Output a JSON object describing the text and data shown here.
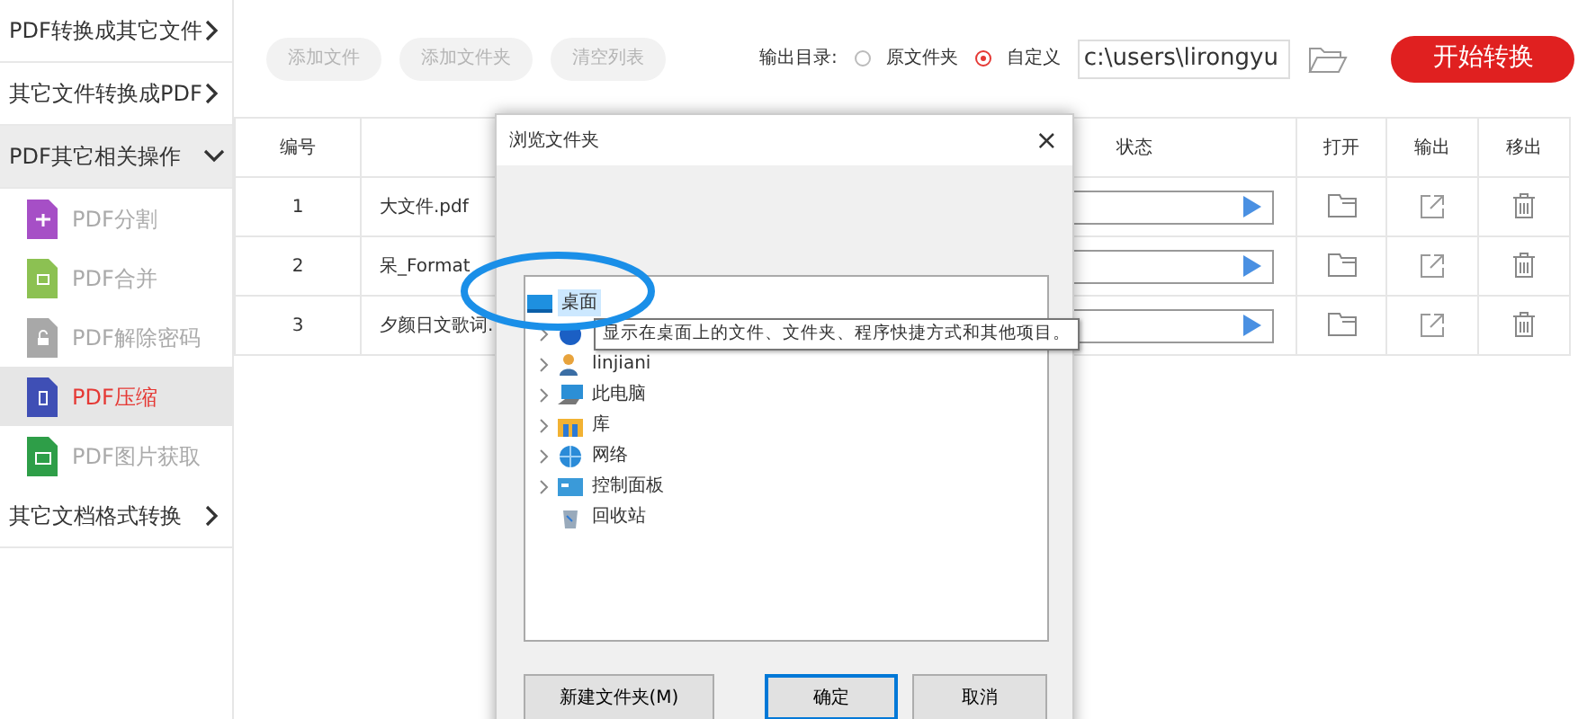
{
  "sidebar": {
    "items": [
      {
        "label": "PDF转换成其它文件",
        "expanded": false
      },
      {
        "label": "其它文件转换成PDF",
        "expanded": false
      },
      {
        "label": "PDF其它相关操作",
        "expanded": true,
        "children": [
          {
            "label": "PDF分割",
            "kind": "split",
            "color": "#a64fc6",
            "selected": false
          },
          {
            "label": "PDF合并",
            "kind": "merge",
            "color": "#8cc152",
            "selected": false
          },
          {
            "label": "PDF解除密码",
            "kind": "unlock",
            "color": "#a8a8a8",
            "selected": false
          },
          {
            "label": "PDF压缩",
            "kind": "compress",
            "color": "#3f4fb5",
            "selected": true
          },
          {
            "label": "PDF图片获取",
            "kind": "image",
            "color": "#2e9e48",
            "selected": false
          }
        ]
      },
      {
        "label": "其它文档格式转换",
        "expanded": false
      }
    ]
  },
  "toolbar": {
    "buttons": [
      "添加文件",
      "添加文件夹",
      "清空列表"
    ],
    "output": {
      "label": "输出目录:",
      "options": [
        {
          "label": "原文件夹",
          "selected": false
        },
        {
          "label": "自定义",
          "selected": true
        }
      ],
      "path": "c:\\users\\lirongyu"
    },
    "start_button": "开始转换"
  },
  "table": {
    "columns": {
      "number": "编号",
      "status": "状态",
      "open": "打开",
      "output": "输出",
      "remove": "移出"
    },
    "rows": [
      {
        "number": "1",
        "file_name": "大文件.pdf"
      },
      {
        "number": "2",
        "file_name": "呆_Format"
      },
      {
        "number": "3",
        "file_name": "夕颜日文歌词."
      }
    ]
  },
  "dialog": {
    "title": "浏览文件夹",
    "close": "×",
    "tree": [
      {
        "label": "桌面",
        "kind": "desktop",
        "selected": true,
        "children": [
          {
            "kind": "cloud",
            "expandable": true
          },
          {
            "label": "linjiani",
            "kind": "user",
            "expandable": true
          },
          {
            "label": "此电脑",
            "kind": "computer",
            "expandable": true
          },
          {
            "label": "库",
            "kind": "library",
            "expandable": true
          },
          {
            "label": "网络",
            "kind": "network",
            "expandable": true
          },
          {
            "label": "控制面板",
            "kind": "control-panel",
            "expandable": true
          },
          {
            "label": "回收站",
            "kind": "recycle-bin",
            "expandable": false
          }
        ]
      }
    ],
    "tooltip": "显示在桌面上的文件、文件夹、程序快捷方式和其他项目。",
    "buttons": [
      {
        "label": "新建文件夹(M)",
        "default": false
      },
      {
        "label": "确定",
        "default": true
      },
      {
        "label": "取消",
        "default": false
      }
    ]
  }
}
